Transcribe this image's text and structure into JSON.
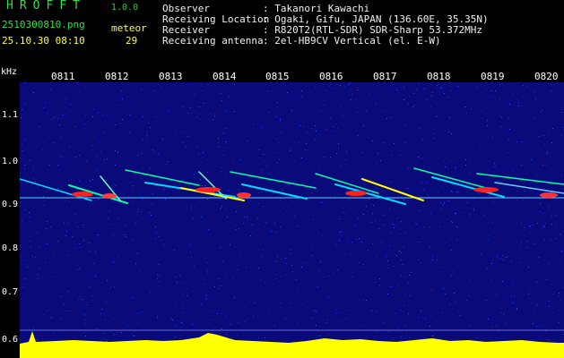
{
  "app": {
    "name": "HROFFT",
    "version": "1.0.0"
  },
  "file": {
    "name": "2510300810.png",
    "datetime": "25.10.30 08:10"
  },
  "meteor": {
    "label": "meteor",
    "count": "29"
  },
  "info": [
    {
      "label": "Observer",
      "value": ": Takanori Kawachi"
    },
    {
      "label": "Receiving Location",
      "value": ": Ogaki, Gifu, JAPAN (136.60E, 35.35N)"
    },
    {
      "label": "Receiver",
      "value": ": R820T2(RTL-SDR) SDR-Sharp 53.372MHz"
    },
    {
      "label": "Receiving antenna",
      "value": ": 2el-HB9CV Vertical (el. E-W)"
    }
  ],
  "spectrogram": {
    "y_unit": "kHz",
    "y_ticks": [
      "1.1",
      "1.0",
      "0.9",
      "0.8",
      "0.7",
      "0.6"
    ],
    "x_ticks": [
      "0811",
      "0812",
      "0813",
      "0814",
      "0815",
      "0816",
      "0817",
      "0818",
      "0819",
      "0820"
    ],
    "colors": {
      "background": "#0a0a7a",
      "signal_low": "#00aaff",
      "signal_mid": "#00ffaa",
      "signal_high": "#ff2020",
      "noise_floor": "#ffff00",
      "noise_base": "#00cccc"
    }
  }
}
